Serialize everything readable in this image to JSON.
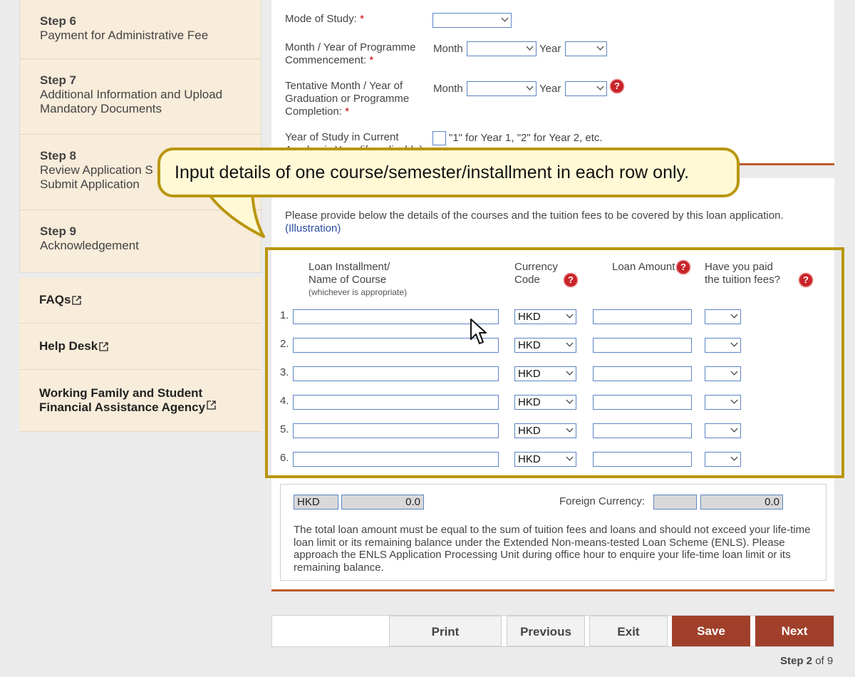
{
  "sidebar": {
    "steps": [
      {
        "num": "Step 6",
        "desc": "Payment for Administrative Fee"
      },
      {
        "num": "Step 7",
        "desc": "Additional Information and Upload Mandatory Documents"
      },
      {
        "num": "Step 8",
        "desc": "Review Application S Submit Application"
      },
      {
        "num": "Step 9",
        "desc": "Acknowledgement"
      }
    ],
    "links": [
      {
        "label": "FAQs"
      },
      {
        "label": "Help Desk"
      },
      {
        "label": "Working Family and Student Financial Assistance Agency"
      }
    ]
  },
  "form_top": {
    "mode_label": "Mode of Study:",
    "req": "*",
    "commence_label": "Month / Year of Programme Commencement:",
    "grad_label": "Tentative Month / Year of Graduation or Programme Completion:",
    "month": "Month",
    "year": "Year",
    "year_of_study_label": "Year of Study in Current Academic Year (if applicable):",
    "year_hint": "\"1\" for Year 1, \"2\" for Year 2, etc."
  },
  "callout": "Input details of one course/semester/installment in each row only.",
  "courses": {
    "intro": "Please provide below the details of the courses and the tuition fees to be covered by this loan application.",
    "illustration_link": "(Illustration)",
    "col_name": "Loan Installment/ Name of Course",
    "col_name_sub": "(whichever is appropriate)",
    "col_currency": "Currency Code",
    "col_amount": "Loan Amount",
    "col_paid": "Have you paid the tuition fees?",
    "rows": [
      {
        "num": "1.",
        "currency": "HKD"
      },
      {
        "num": "2.",
        "currency": "HKD"
      },
      {
        "num": "3.",
        "currency": "HKD"
      },
      {
        "num": "4.",
        "currency": "HKD"
      },
      {
        "num": "5.",
        "currency": "HKD"
      },
      {
        "num": "6.",
        "currency": "HKD"
      }
    ]
  },
  "summary": {
    "hkd_code": "HKD",
    "hkd_total": "0.0",
    "foreign_label": "Foreign Currency:",
    "foreign_total": "0.0",
    "note": "The total loan amount must be equal to the sum of tuition fees and loans and should not exceed your life-time loan limit or its remaining balance under the Extended Non-means-tested Loan Scheme (ENLS). Please approach the ENLS Application Processing Unit during office hour to enquire your life-time loan limit or its remaining balance."
  },
  "buttons": {
    "print": "Print",
    "previous": "Previous",
    "exit": "Exit",
    "save": "Save",
    "next": "Next"
  },
  "progress": {
    "step_word": "Step 2",
    "of": "of 9"
  },
  "colors": {
    "accent": "#c05a2a",
    "button_red": "#a0402a",
    "highlight": "#b9960e",
    "sidebar_bg": "#f8ecda"
  }
}
